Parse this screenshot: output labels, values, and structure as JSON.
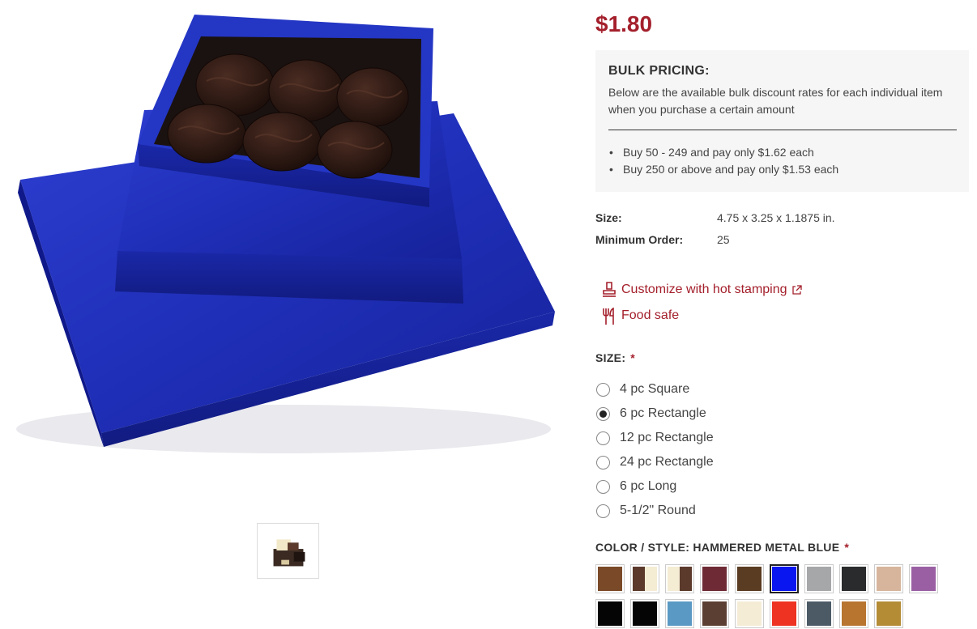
{
  "price": "$1.80",
  "bulk_pricing": {
    "title": "BULK PRICING:",
    "description": "Below are the available bulk discount rates for each individual item when you purchase a certain amount",
    "tiers": [
      "Buy 50 - 249 and pay only $1.62 each",
      "Buy 250 or above and pay only $1.53 each"
    ]
  },
  "specs": [
    {
      "label": "Size:",
      "value": "4.75 x 3.25 x 1.1875 in."
    },
    {
      "label": "Minimum Order:",
      "value": "25"
    }
  ],
  "features": {
    "hot_stamping": "Customize with hot stamping",
    "food_safe": "Food safe"
  },
  "size": {
    "title": "SIZE:",
    "required": "*",
    "options": [
      "4 pc Square",
      "6 pc Rectangle",
      "12 pc Rectangle",
      "24 pc Rectangle",
      "6 pc Long",
      "5-1/2\" Round"
    ],
    "selected": "6 pc Rectangle"
  },
  "color": {
    "title": "COLOR / STYLE: HAMMERED METAL BLUE",
    "required": "*",
    "swatches": [
      {
        "colors": [
          "#7a4a28"
        ]
      },
      {
        "colors": [
          "#5b3a2b",
          "#f4ecd3"
        ]
      },
      {
        "colors": [
          "#f4ecd3",
          "#5b3a2b"
        ]
      },
      {
        "colors": [
          "#6e2a35"
        ]
      },
      {
        "colors": [
          "#5a3c22"
        ]
      },
      {
        "colors": [
          "#0a16f0"
        ],
        "selected": true
      },
      {
        "colors": [
          "#a6a7a9"
        ]
      },
      {
        "colors": [
          "#2a2b2d"
        ]
      },
      {
        "colors": [
          "#d6b59c"
        ]
      },
      {
        "colors": [
          "#9a5fa3"
        ]
      },
      {
        "colors": [
          "#050505"
        ]
      },
      {
        "colors": [
          "#050505"
        ]
      },
      {
        "colors": [
          "#5a99c4"
        ]
      },
      {
        "colors": [
          "#5b3f32"
        ]
      },
      {
        "colors": [
          "#f5ecd6"
        ]
      },
      {
        "colors": [
          "#ee3322"
        ]
      },
      {
        "colors": [
          "#4c5a66"
        ]
      },
      {
        "colors": [
          "#b87530"
        ]
      },
      {
        "colors": [
          "#b48c36"
        ]
      }
    ]
  },
  "colors": {
    "accent": "#a4202c",
    "box_blue": "#1f2fb8",
    "chocolate": "#2a1712"
  }
}
